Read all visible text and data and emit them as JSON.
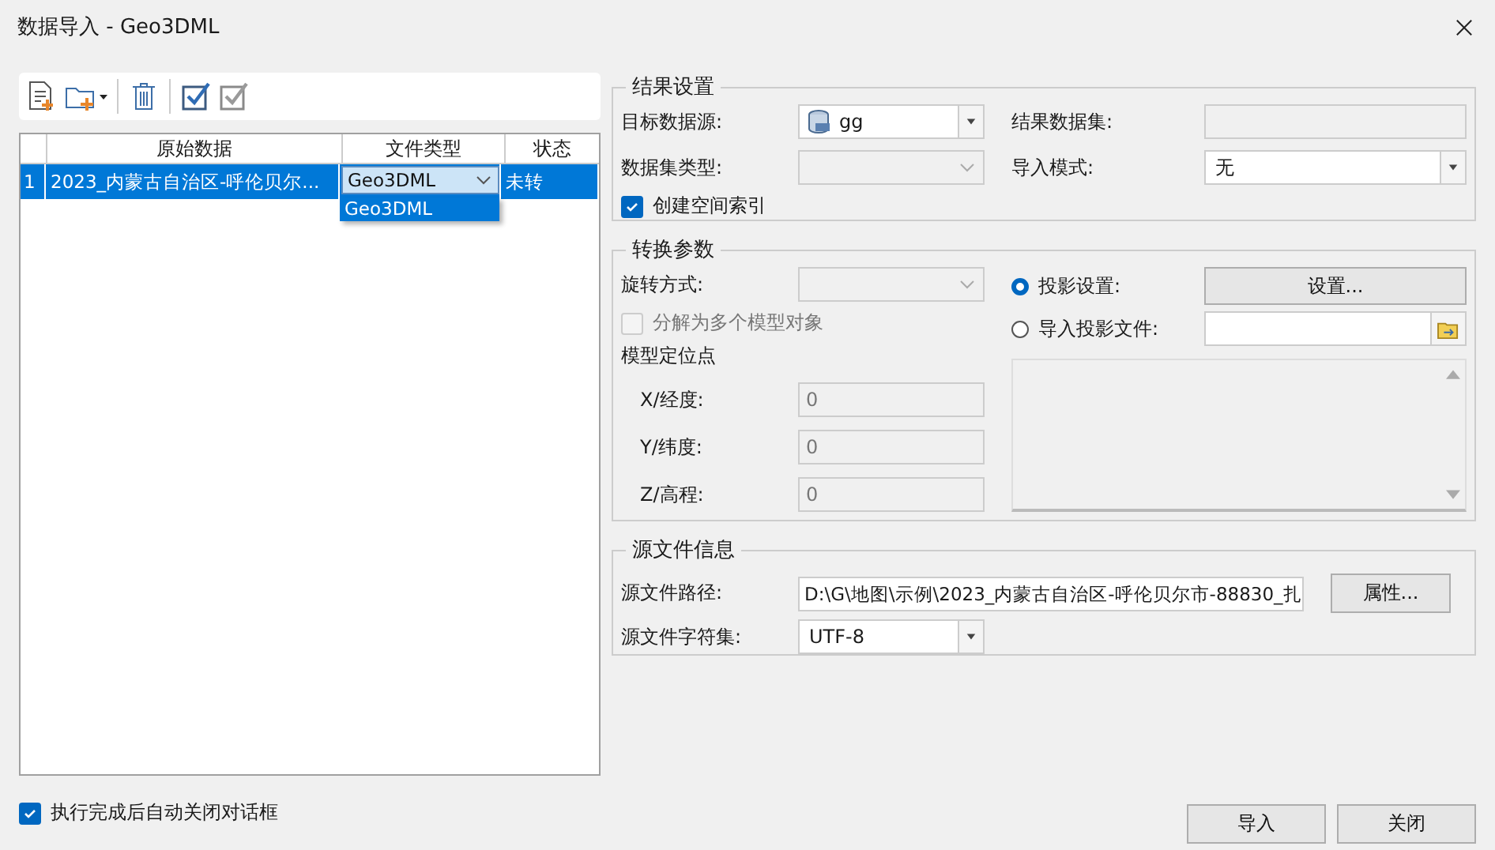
{
  "window": {
    "title": "数据导入 - Geo3DML"
  },
  "table": {
    "columns": [
      "原始数据",
      "文件类型",
      "状态"
    ],
    "rows": [
      {
        "index": "1",
        "source": "2023_内蒙古自治区-呼伦贝尔...",
        "file_type": "Geo3DML",
        "status": "未转",
        "selected": true
      }
    ],
    "dropdown_options": [
      {
        "label": "Geo3DML",
        "selected": true
      }
    ]
  },
  "result_settings": {
    "title": "结果设置",
    "target_datasource": {
      "label": "目标数据源:",
      "value": "gg"
    },
    "result_dataset": {
      "label": "结果数据集:",
      "disabled": true
    },
    "dataset_type": {
      "label": "数据集类型:",
      "disabled": true
    },
    "import_mode": {
      "label": "导入模式:",
      "value": "无"
    },
    "spatial_index": {
      "label": "创建空间索引",
      "checked": true
    }
  },
  "conversion": {
    "title": "转换参数",
    "rotation": {
      "label": "旋转方式:",
      "disabled": true
    },
    "split_models": {
      "label": "分解为多个模型对象",
      "checked": false,
      "disabled": true
    },
    "position_label": "模型定位点",
    "coords": [
      {
        "label": "X/经度:",
        "value": "0",
        "disabled": true
      },
      {
        "label": "Y/纬度:",
        "value": "0",
        "disabled": true
      },
      {
        "label": "Z/高程:",
        "value": "0",
        "disabled": true
      }
    ],
    "projection_options": [
      {
        "label": "投影设置:",
        "selected": true,
        "kind": "button",
        "button": "设置..."
      },
      {
        "label": "导入投影文件:",
        "selected": false,
        "kind": "file"
      }
    ]
  },
  "source_info": {
    "title": "源文件信息",
    "path": {
      "label": "源文件路径:",
      "value": "D:\\G\\地图\\示例\\2023_内蒙古自治区-呼伦贝尔市-88830_扎"
    },
    "charset": {
      "label": "源文件字符集:",
      "value": "UTF-8"
    },
    "properties_button": "属性..."
  },
  "auto_close": {
    "label": "执行完成后自动关闭对话框",
    "checked": true
  },
  "buttons": [
    "导入",
    "关闭"
  ]
}
